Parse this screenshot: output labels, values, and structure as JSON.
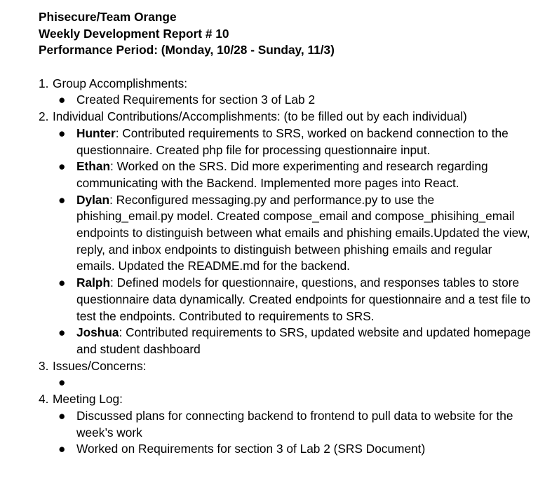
{
  "header": {
    "line1": "Phisecure/Team Orange",
    "line2": "Weekly Development Report # 10",
    "line3": "Performance Period: (Monday, 10/28 - Sunday, 11/3)"
  },
  "bullet_glyph": "●",
  "sections": [
    {
      "number": "1.",
      "title": "Group Accomplishments:",
      "items": [
        {
          "text": "Created Requirements for section 3 of Lab 2"
        }
      ]
    },
    {
      "number": "2.",
      "title": "Individual Contributions/Accomplishments: (to be filled out by each individual)",
      "items": [
        {
          "name": "Hunter",
          "text": ": Contributed requirements to SRS, worked on backend connection to the questionnaire. Created php file for processing questionnaire input."
        },
        {
          "name": "Ethan",
          "text": ": Worked on the SRS. Did more experimenting and research regarding communicating with the Backend. Implemented more pages into React."
        },
        {
          "name": "Dylan",
          "text": ": Reconfigured messaging.py and performance.py to use the phishing_email.py model. Created compose_email and compose_phisihing_email endpoints to distinguish between what emails and phishing emails.Updated the view, reply, and inbox endpoints to distinguish between phishing emails and regular emails. Updated the README.md for the backend."
        },
        {
          "name": "Ralph",
          "text": ": Defined models for questionnaire, questions, and responses tables to store questionnaire data dynamically. Created endpoints for questionnaire and a test file to test the endpoints. Contributed to requirements to SRS."
        },
        {
          "name": "Joshua",
          "text": ": Contributed requirements to SRS, updated website and updated homepage and student dashboard"
        }
      ]
    },
    {
      "number": "3.",
      "title": "Issues/Concerns:",
      "items": [
        {
          "text": ""
        }
      ]
    },
    {
      "number": "4.",
      "title": "Meeting Log:",
      "items": [
        {
          "text": "Discussed plans for connecting backend to frontend to pull data to website for the week’s work"
        },
        {
          "text": "Worked on Requirements for section 3 of Lab 2 (SRS Document)"
        }
      ]
    }
  ]
}
